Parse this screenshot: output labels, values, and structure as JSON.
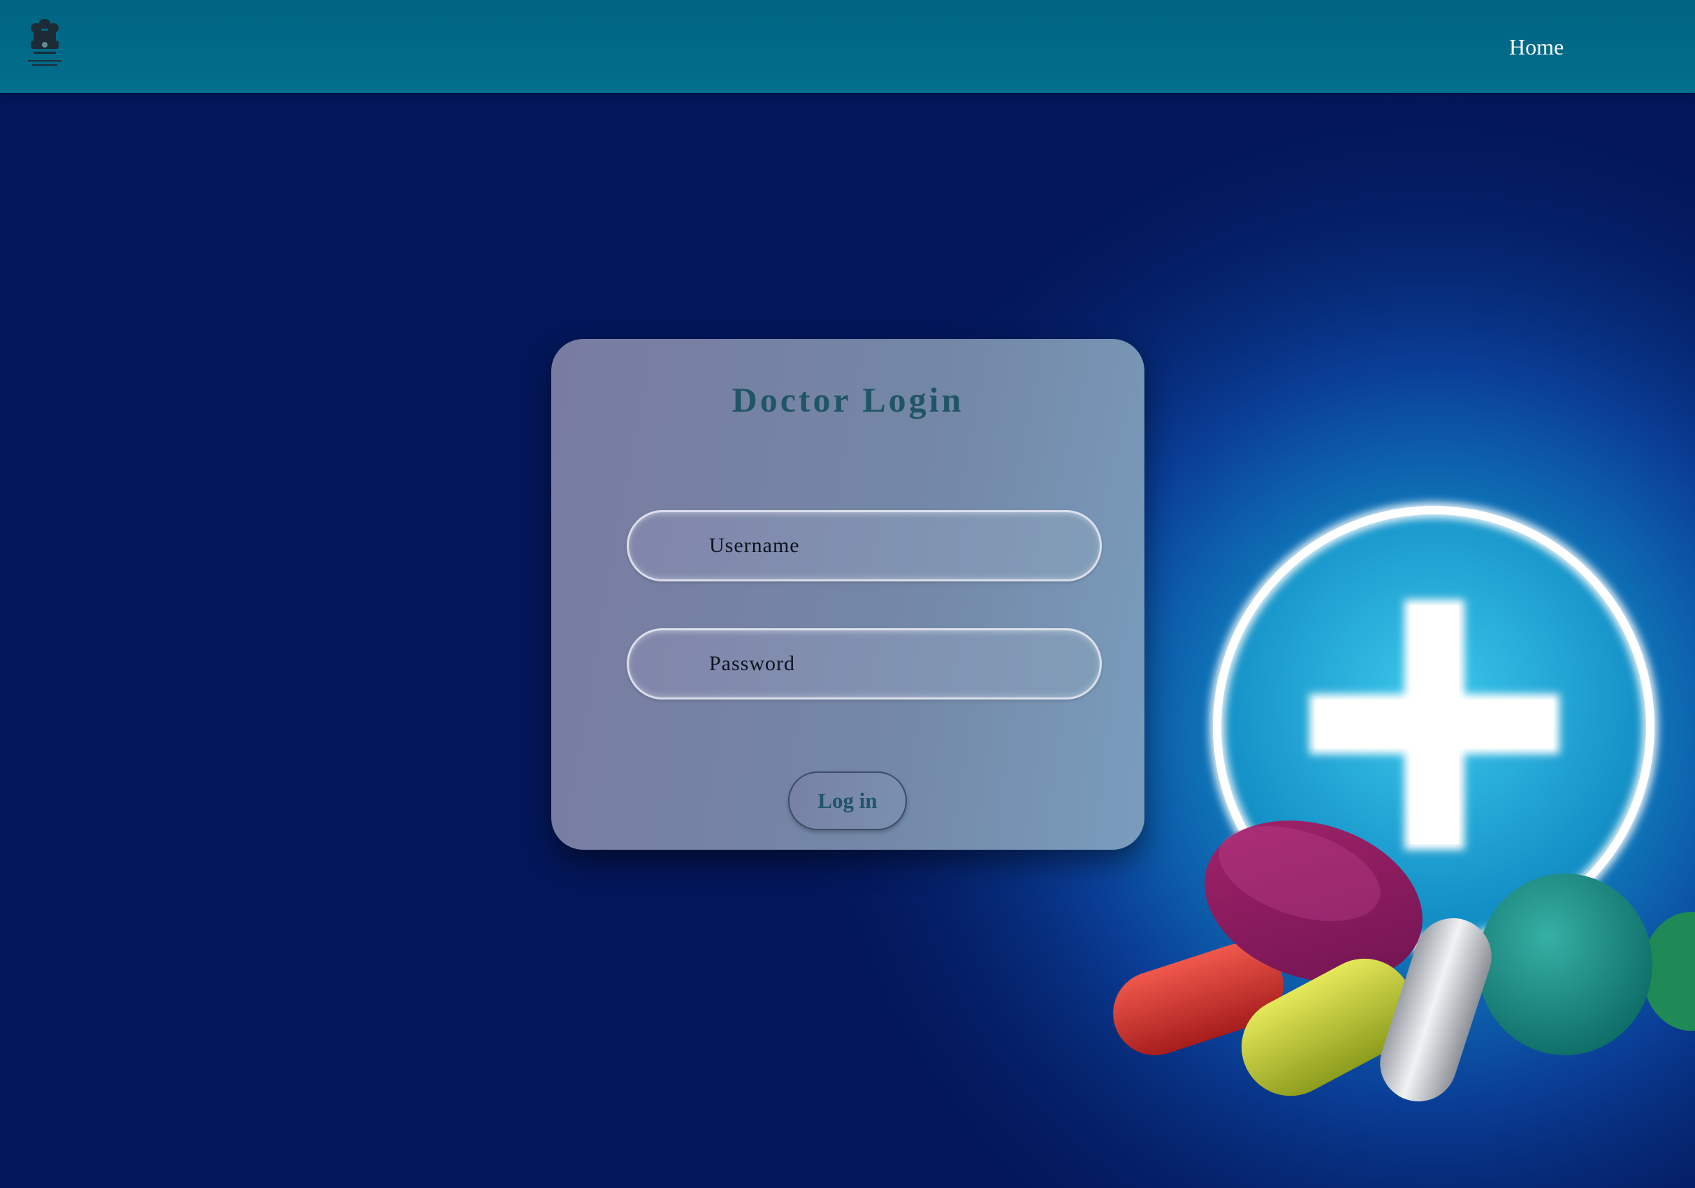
{
  "navbar": {
    "home_label": "Home",
    "emblem_icon": "national-emblem-icon"
  },
  "login": {
    "title": "Doctor Login",
    "username_placeholder": "Username",
    "username_value": "",
    "password_placeholder": "Password",
    "password_value": "",
    "submit_label": "Log in"
  },
  "colors": {
    "navbar_bg": "#006482",
    "page_bg": "#031659",
    "title_color": "#1f5566",
    "card_bg": "#7a86a8"
  }
}
